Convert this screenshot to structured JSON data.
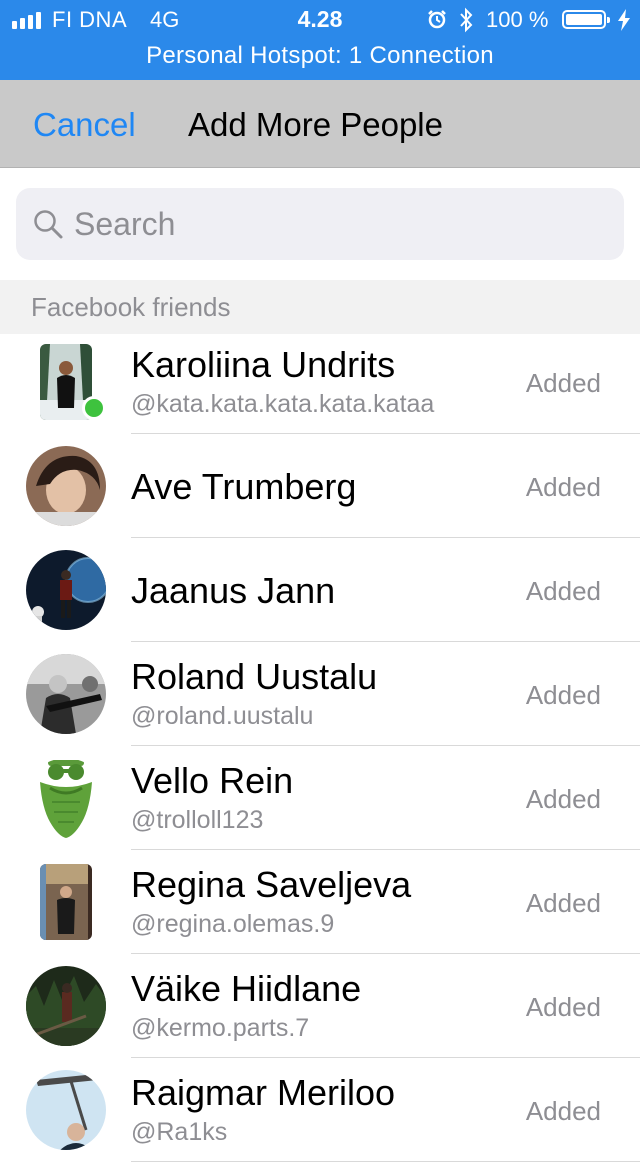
{
  "status_bar": {
    "carrier": "FI DNA",
    "network": "4G",
    "time": "4.28",
    "battery_percent": "100 %",
    "battery_level": 1.0,
    "hotspot": "Personal Hotspot: 1 Connection",
    "bar_color": "#2b89ea",
    "icons": [
      "signal-icon",
      "alarm-icon",
      "bluetooth-icon",
      "battery-icon",
      "charging-icon"
    ]
  },
  "nav": {
    "cancel_label": "Cancel",
    "title": "Add More People",
    "accent_color": "#1f87f4"
  },
  "search": {
    "placeholder": "Search",
    "value": "",
    "icon": "search-icon"
  },
  "section": {
    "header": "Facebook friends"
  },
  "friends": [
    {
      "name": "Karoliina Undrits",
      "handle": "@kata.kata.kata.kata.kataa",
      "status": "Added",
      "online": true
    },
    {
      "name": "Ave Trumberg",
      "handle": "",
      "status": "Added",
      "online": false
    },
    {
      "name": "Jaanus Jann",
      "handle": "",
      "status": "Added",
      "online": false
    },
    {
      "name": "Roland Uustalu",
      "handle": "@roland.uustalu",
      "status": "Added",
      "online": false
    },
    {
      "name": "Vello Rein",
      "handle": "@trolloll123",
      "status": "Added",
      "online": false
    },
    {
      "name": "Regina Saveljeva",
      "handle": "@regina.olemas.9",
      "status": "Added",
      "online": false
    },
    {
      "name": "Väike Hiidlane",
      "handle": "@kermo.parts.7",
      "status": "Added",
      "online": false
    },
    {
      "name": "Raigmar Meriloo",
      "handle": "@Ra1ks",
      "status": "Added",
      "online": false
    }
  ]
}
